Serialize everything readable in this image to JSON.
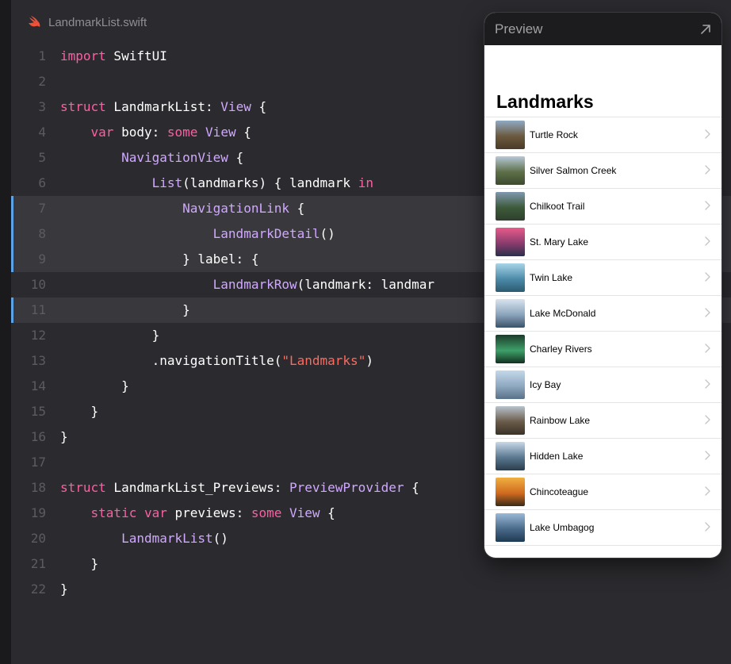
{
  "editor": {
    "filename": "LandmarkList.swift",
    "lines": [
      {
        "n": "1",
        "tokens": [
          {
            "t": "import",
            "c": "kw"
          },
          {
            "t": " SwiftUI",
            "c": "pl"
          }
        ]
      },
      {
        "n": "2",
        "tokens": []
      },
      {
        "n": "3",
        "tokens": [
          {
            "t": "struct",
            "c": "kw"
          },
          {
            "t": " LandmarkList: ",
            "c": "pl"
          },
          {
            "t": "View",
            "c": "ty"
          },
          {
            "t": " {",
            "c": "pl"
          }
        ]
      },
      {
        "n": "4",
        "tokens": [
          {
            "t": "    ",
            "c": "pl"
          },
          {
            "t": "var",
            "c": "kw"
          },
          {
            "t": " body: ",
            "c": "pl"
          },
          {
            "t": "some",
            "c": "kw"
          },
          {
            "t": " ",
            "c": "pl"
          },
          {
            "t": "View",
            "c": "ty"
          },
          {
            "t": " {",
            "c": "pl"
          }
        ]
      },
      {
        "n": "5",
        "tokens": [
          {
            "t": "        ",
            "c": "pl"
          },
          {
            "t": "NavigationView",
            "c": "ty"
          },
          {
            "t": " {",
            "c": "pl"
          }
        ]
      },
      {
        "n": "6",
        "tokens": [
          {
            "t": "            ",
            "c": "pl"
          },
          {
            "t": "List",
            "c": "ty"
          },
          {
            "t": "(landmarks) { landmark ",
            "c": "pl"
          },
          {
            "t": "in",
            "c": "kw"
          }
        ]
      },
      {
        "n": "7",
        "hl": true,
        "mark": true,
        "tokens": [
          {
            "t": "                ",
            "c": "pl"
          },
          {
            "t": "NavigationLink",
            "c": "ty"
          },
          {
            "t": " {",
            "c": "pl"
          }
        ]
      },
      {
        "n": "8",
        "hl": true,
        "mark": true,
        "tokens": [
          {
            "t": "                    ",
            "c": "pl"
          },
          {
            "t": "LandmarkDetail",
            "c": "ty"
          },
          {
            "t": "()",
            "c": "pl"
          }
        ]
      },
      {
        "n": "9",
        "hl": true,
        "mark": true,
        "tokens": [
          {
            "t": "                } label: {",
            "c": "pl"
          }
        ]
      },
      {
        "n": "10",
        "tokens": [
          {
            "t": "                    ",
            "c": "pl"
          },
          {
            "t": "LandmarkRow",
            "c": "ty"
          },
          {
            "t": "(landmark: landmar",
            "c": "pl"
          }
        ]
      },
      {
        "n": "11",
        "hl": true,
        "mark": true,
        "tokens": [
          {
            "t": "                }",
            "c": "pl"
          }
        ]
      },
      {
        "n": "12",
        "tokens": [
          {
            "t": "            }",
            "c": "pl"
          }
        ]
      },
      {
        "n": "13",
        "tokens": [
          {
            "t": "            .navigationTitle(",
            "c": "pl"
          },
          {
            "t": "\"Landmarks\"",
            "c": "str"
          },
          {
            "t": ")",
            "c": "pl"
          }
        ]
      },
      {
        "n": "14",
        "tokens": [
          {
            "t": "        }",
            "c": "pl"
          }
        ]
      },
      {
        "n": "15",
        "tokens": [
          {
            "t": "    }",
            "c": "pl"
          }
        ]
      },
      {
        "n": "16",
        "tokens": [
          {
            "t": "}",
            "c": "pl"
          }
        ]
      },
      {
        "n": "17",
        "tokens": []
      },
      {
        "n": "18",
        "tokens": [
          {
            "t": "struct",
            "c": "kw"
          },
          {
            "t": " LandmarkList_Previews: ",
            "c": "pl"
          },
          {
            "t": "PreviewProvider",
            "c": "ty"
          },
          {
            "t": " {",
            "c": "pl"
          }
        ]
      },
      {
        "n": "19",
        "tokens": [
          {
            "t": "    ",
            "c": "pl"
          },
          {
            "t": "static",
            "c": "kw"
          },
          {
            "t": " ",
            "c": "pl"
          },
          {
            "t": "var",
            "c": "kw"
          },
          {
            "t": " previews: ",
            "c": "pl"
          },
          {
            "t": "some",
            "c": "kw"
          },
          {
            "t": " ",
            "c": "pl"
          },
          {
            "t": "View",
            "c": "ty"
          },
          {
            "t": " {",
            "c": "pl"
          }
        ]
      },
      {
        "n": "20",
        "tokens": [
          {
            "t": "        ",
            "c": "pl"
          },
          {
            "t": "LandmarkList",
            "c": "ty"
          },
          {
            "t": "()",
            "c": "pl"
          }
        ]
      },
      {
        "n": "21",
        "tokens": [
          {
            "t": "    }",
            "c": "pl"
          }
        ]
      },
      {
        "n": "22",
        "tokens": [
          {
            "t": "}",
            "c": "pl"
          }
        ]
      }
    ]
  },
  "preview": {
    "title": "Preview",
    "screen_title": "Landmarks",
    "items": [
      {
        "label": "Turtle Rock",
        "colors": [
          "#8fa9c4",
          "#6b5a3e",
          "#4a3a28"
        ]
      },
      {
        "label": "Silver Salmon Creek",
        "colors": [
          "#b8c8d8",
          "#5d7048",
          "#3e4a30"
        ]
      },
      {
        "label": "Chilkoot Trail",
        "colors": [
          "#7f98b0",
          "#3d5a3a",
          "#2e3f2c"
        ]
      },
      {
        "label": "St. Mary Lake",
        "colors": [
          "#e85a8a",
          "#8a3c6e",
          "#2a2f4a"
        ]
      },
      {
        "label": "Twin Lake",
        "colors": [
          "#a8d4e8",
          "#4c8aa8",
          "#2c5a70"
        ]
      },
      {
        "label": "Lake McDonald",
        "colors": [
          "#d8e4ee",
          "#8aa4bc",
          "#3a5268"
        ]
      },
      {
        "label": "Charley Rivers",
        "colors": [
          "#1c3a2a",
          "#3ea06a",
          "#123020"
        ]
      },
      {
        "label": "Icy Bay",
        "colors": [
          "#c4d8ea",
          "#8ea8c0",
          "#5a7288"
        ]
      },
      {
        "label": "Rainbow Lake",
        "colors": [
          "#b8c4cc",
          "#6a5a48",
          "#3a3228"
        ]
      },
      {
        "label": "Hidden Lake",
        "colors": [
          "#c8d8e8",
          "#5a7890",
          "#2a3c4c"
        ]
      },
      {
        "label": "Chincoteague",
        "colors": [
          "#f0b040",
          "#d06a20",
          "#3a2a18"
        ]
      },
      {
        "label": "Lake Umbagog",
        "colors": [
          "#9ab8d8",
          "#4a6a8a",
          "#1e3a52"
        ]
      }
    ]
  },
  "icons": {
    "file": "swift-icon",
    "expand": "arrow-up-right-icon",
    "row_disclosure": "chevron-right-icon"
  },
  "colors": {
    "editor_bg": "#2b2b2f",
    "keyword": "#fc5fa3",
    "type": "#d0a8ff",
    "string": "#fc6a5d",
    "line_number": "#5b5b61",
    "highlight": "#38383d",
    "change_marker": "#5ba3e6",
    "swift_orange": "#f05138"
  }
}
